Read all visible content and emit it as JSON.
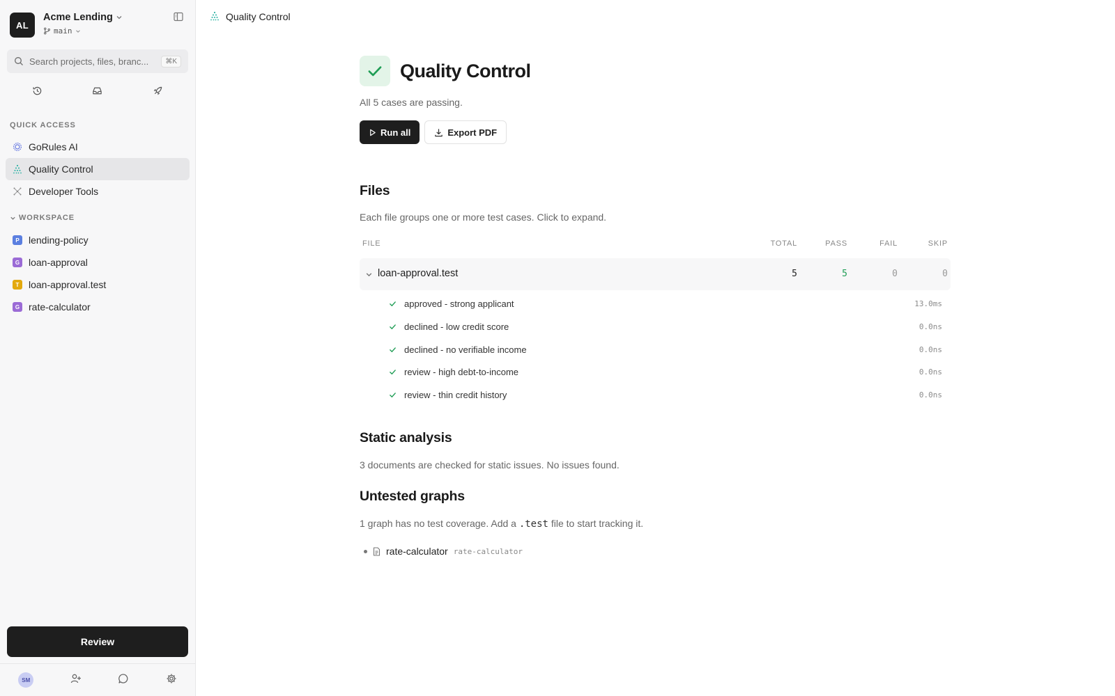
{
  "org": {
    "avatar": "AL",
    "name": "Acme Lending",
    "branch": "main"
  },
  "search": {
    "placeholder": "Search projects, files, branc...",
    "shortcut": "⌘K"
  },
  "sidebar": {
    "quick_access_label": "QUICK ACCESS",
    "quick_access": [
      {
        "label": "GoRules AI"
      },
      {
        "label": "Quality Control"
      },
      {
        "label": "Developer Tools"
      }
    ],
    "workspace_label": "WORKSPACE",
    "workspace": [
      {
        "badge": "P",
        "label": "lending-policy",
        "color": "#5b7fe0"
      },
      {
        "badge": "G",
        "label": "loan-approval",
        "color": "#9b6bd6"
      },
      {
        "badge": "T",
        "label": "loan-approval.test",
        "color": "#e3a90d"
      },
      {
        "badge": "G",
        "label": "rate-calculator",
        "color": "#9b6bd6"
      }
    ],
    "review_label": "Review",
    "user_avatar": "SM"
  },
  "topbar": {
    "title": "Quality Control"
  },
  "main": {
    "title": "Quality Control",
    "subtitle": "All 5 cases are passing.",
    "run_all": "Run all",
    "export_pdf": "Export PDF",
    "files_heading": "Files",
    "files_desc": "Each file groups one or more test cases. Click to expand.",
    "columns": {
      "file": "FILE",
      "total": "TOTAL",
      "pass": "PASS",
      "fail": "FAIL",
      "skip": "SKIP"
    },
    "file": {
      "name": "loan-approval.test",
      "total": "5",
      "pass": "5",
      "fail": "0",
      "skip": "0"
    },
    "cases": [
      {
        "name": "approved - strong applicant",
        "time": "13.0ms"
      },
      {
        "name": "declined - low credit score",
        "time": "0.0ns"
      },
      {
        "name": "declined - no verifiable income",
        "time": "0.0ns"
      },
      {
        "name": "review - high debt-to-income",
        "time": "0.0ns"
      },
      {
        "name": "review - thin credit history",
        "time": "0.0ns"
      }
    ],
    "static_heading": "Static analysis",
    "static_desc": "3 documents are checked for static issues. No issues found.",
    "untested_heading": "Untested graphs",
    "untested_desc_pre": "1 graph has no test coverage. Add a ",
    "untested_desc_code": ".test",
    "untested_desc_post": " file to start tracking it.",
    "untested_item": {
      "name": "rate-calculator",
      "slug": "rate-calculator"
    }
  },
  "colors": {
    "accent_green": "#1f9d55",
    "dark": "#1e1e1e",
    "teal": "#2bb3a3"
  }
}
